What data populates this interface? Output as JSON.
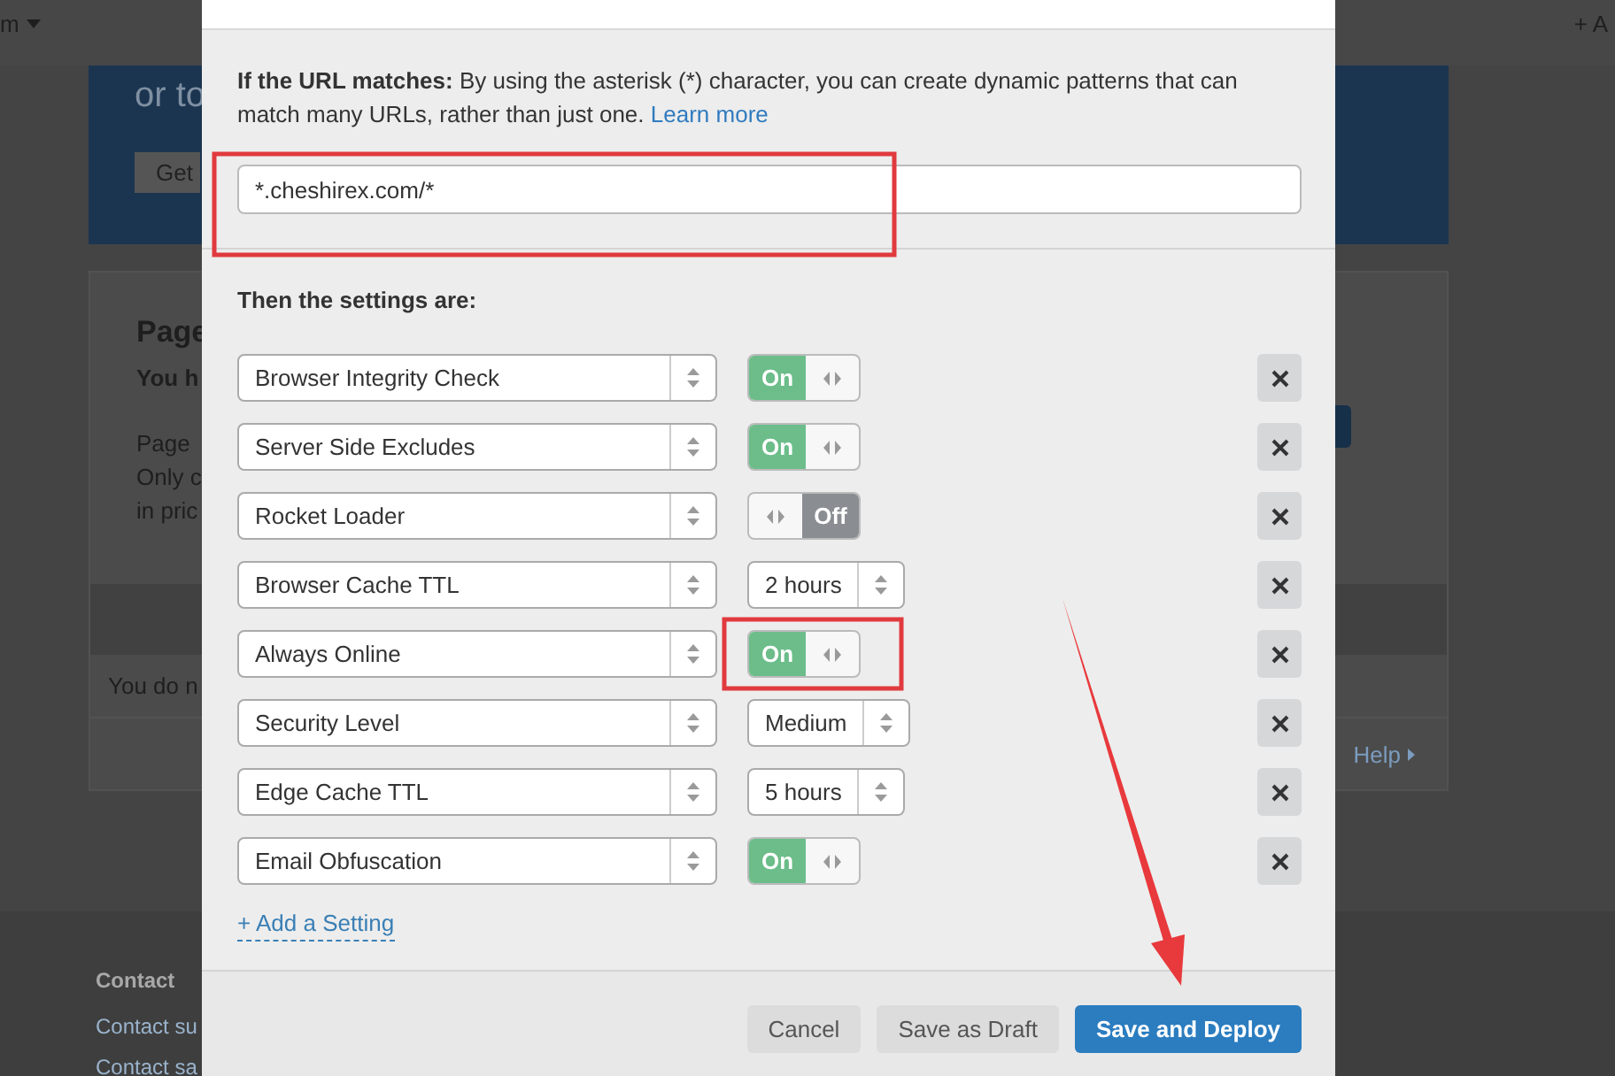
{
  "background": {
    "menu": "m",
    "add": "+ A",
    "banner_text": "or to",
    "banner_button": "Get",
    "card": {
      "title": "Page",
      "subtitle": "You h",
      "lines": [
        "Page",
        "Only c",
        "in pric"
      ]
    },
    "notice": "You do n",
    "help_link": "Help",
    "footer": {
      "heading": "Contact",
      "links": [
        "Contact su",
        "Contact sa"
      ]
    }
  },
  "modal": {
    "url_rule": {
      "label": "If the URL matches:",
      "description": "By using the asterisk (*) character, you can create dynamic patterns that can match many URLs, rather than just one.",
      "link": "Learn more"
    },
    "url_field": {
      "value": "*.cheshirex.com/*"
    },
    "settings_heading": "Then the settings are:",
    "settings": [
      {
        "name": "Browser Integrity Check",
        "kind": "toggle",
        "on": true,
        "label": "On"
      },
      {
        "name": "Server Side Excludes",
        "kind": "toggle",
        "on": true,
        "label": "On"
      },
      {
        "name": "Rocket Loader",
        "kind": "toggle",
        "on": false,
        "label": "Off"
      },
      {
        "name": "Browser Cache TTL",
        "kind": "select",
        "value": "2 hours"
      },
      {
        "name": "Always Online",
        "kind": "toggle",
        "on": true,
        "label": "On"
      },
      {
        "name": "Security Level",
        "kind": "select",
        "value": "Medium"
      },
      {
        "name": "Edge Cache TTL",
        "kind": "select",
        "value": "5 hours"
      },
      {
        "name": "Email Obfuscation",
        "kind": "toggle",
        "on": true,
        "label": "On"
      }
    ],
    "add_setting": "+ Add a Setting",
    "buttons": [
      {
        "label": "Cancel",
        "kind": "secondary"
      },
      {
        "label": "Save as Draft",
        "kind": "secondary"
      },
      {
        "label": "Save and Deploy",
        "kind": "primary"
      }
    ]
  }
}
